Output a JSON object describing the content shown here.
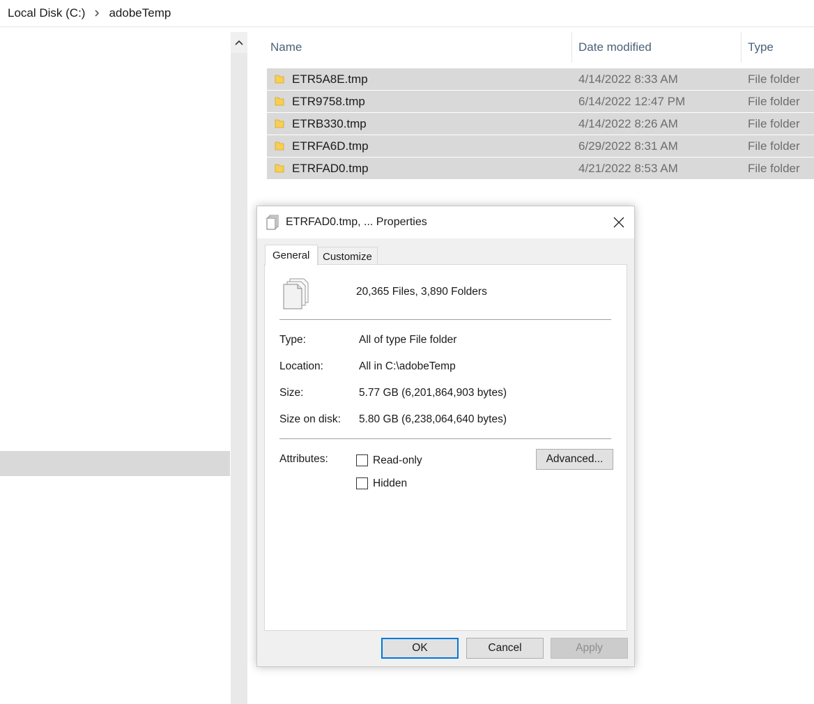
{
  "breadcrumb": {
    "items": [
      "Local Disk (C:)",
      "adobeTemp"
    ]
  },
  "file_list": {
    "columns": {
      "name": "Name",
      "date": "Date modified",
      "type": "Type"
    },
    "rows": [
      {
        "name": "ETR5A8E.tmp",
        "date": "4/14/2022 8:33 AM",
        "type": "File folder"
      },
      {
        "name": "ETR9758.tmp",
        "date": "6/14/2022 12:47 PM",
        "type": "File folder"
      },
      {
        "name": "ETRB330.tmp",
        "date": "4/14/2022 8:26 AM",
        "type": "File folder"
      },
      {
        "name": "ETRFA6D.tmp",
        "date": "6/29/2022 8:31 AM",
        "type": "File folder"
      },
      {
        "name": "ETRFAD0.tmp",
        "date": "4/21/2022 8:53 AM",
        "type": "File folder"
      }
    ]
  },
  "dialog": {
    "title": "ETRFAD0.tmp, ... Properties",
    "tabs": {
      "general": "General",
      "customize": "Customize"
    },
    "summary": "20,365 Files, 3,890 Folders",
    "props": {
      "type_label": "Type:",
      "type_value": "All of type File folder",
      "location_label": "Location:",
      "location_value": "All in C:\\adobeTemp",
      "size_label": "Size:",
      "size_value": "5.77 GB (6,201,864,903 bytes)",
      "size_on_disk_label": "Size on disk:",
      "size_on_disk_value": "5.80 GB (6,238,064,640 bytes)"
    },
    "attributes": {
      "label": "Attributes:",
      "read_only": "Read-only",
      "hidden": "Hidden",
      "advanced": "Advanced..."
    },
    "buttons": {
      "ok": "OK",
      "cancel": "Cancel",
      "apply": "Apply"
    }
  },
  "colors": {
    "selection": "#d9d9d9",
    "folder_yellow": "#f7cf52",
    "focus_blue": "#0078d7"
  }
}
